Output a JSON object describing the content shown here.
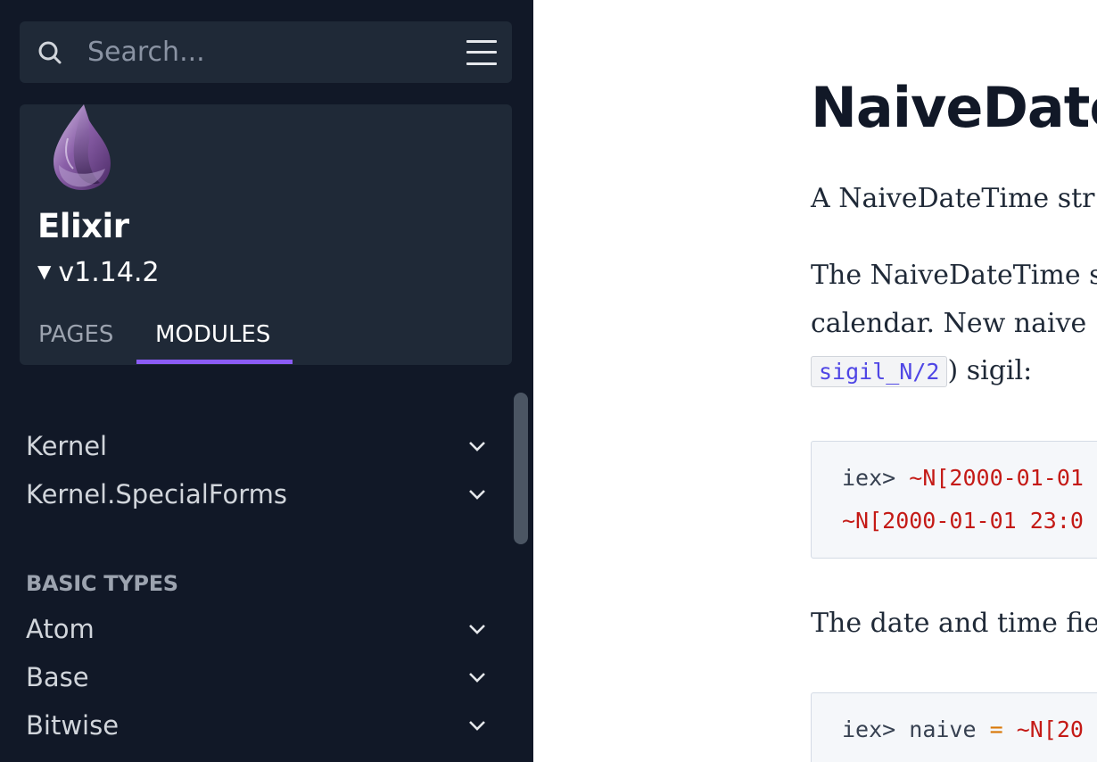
{
  "sidebar": {
    "search": {
      "placeholder": "Search..."
    },
    "project": {
      "name": "Elixir",
      "version": "v1.14.2"
    },
    "tabs": {
      "pages": "PAGES",
      "modules": "MODULES"
    },
    "items_top": [
      {
        "label": "Kernel"
      },
      {
        "label": "Kernel.SpecialForms"
      }
    ],
    "group": {
      "heading": "BASIC TYPES",
      "items": [
        {
          "label": "Atom"
        },
        {
          "label": "Base"
        },
        {
          "label": "Bitwise"
        }
      ]
    }
  },
  "content": {
    "title": "NaiveDateT",
    "para1": "A NaiveDateTime str",
    "para2_line1": "The NaiveDateTime s",
    "para2_line2": "calendar. New naive",
    "para2_code": "sigil_N/2",
    "para2_tail": ") sigil:",
    "code1": {
      "line1_prompt": "iex> ",
      "line1_value": "~N[2000-01-01",
      "line2_value": "~N[2000-01-01 23:0"
    },
    "para3": "The date and time fie",
    "code2": {
      "prompt": "iex> ",
      "var": "naive ",
      "op": "=",
      "value": " ~N[20"
    }
  },
  "colors": {
    "sidebar_bg": "#111827",
    "panel_bg": "#1f2937",
    "accent": "#8b5cf6",
    "code_red": "#c41a16"
  },
  "icons": {
    "search": "search-icon",
    "menu": "hamburger-menu-icon",
    "logo": "elixir-drop-logo",
    "chevron": "chevron-down-icon"
  }
}
